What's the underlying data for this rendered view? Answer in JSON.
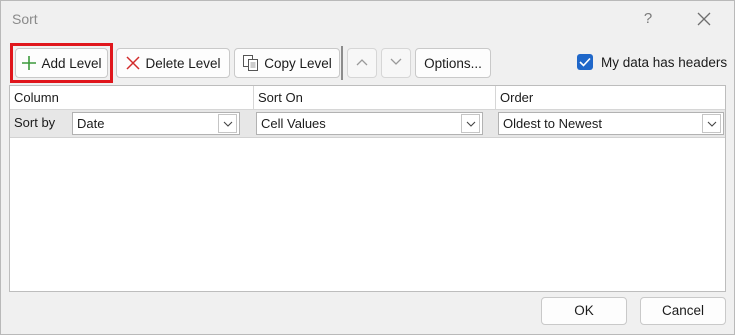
{
  "window": {
    "title": "Sort",
    "help_label": "?"
  },
  "toolbar": {
    "add_level_label": "Add Level",
    "delete_level_label": "Delete Level",
    "copy_level_label": "Copy Level",
    "options_label": "Options...",
    "headers_checkbox": {
      "label": "My data has headers",
      "checked": true
    }
  },
  "grid": {
    "columns": [
      "Column",
      "Sort On",
      "Order"
    ],
    "rows": [
      {
        "label": "Sort by",
        "column": "Date",
        "sort_on": "Cell Values",
        "order": "Oldest to Newest"
      }
    ]
  },
  "footer": {
    "ok_label": "OK",
    "cancel_label": "Cancel"
  },
  "colors": {
    "highlight": "#e0161c",
    "accent": "#1f67c9",
    "add_icon": "#3c9a3c",
    "delete_icon": "#d22b2b"
  }
}
